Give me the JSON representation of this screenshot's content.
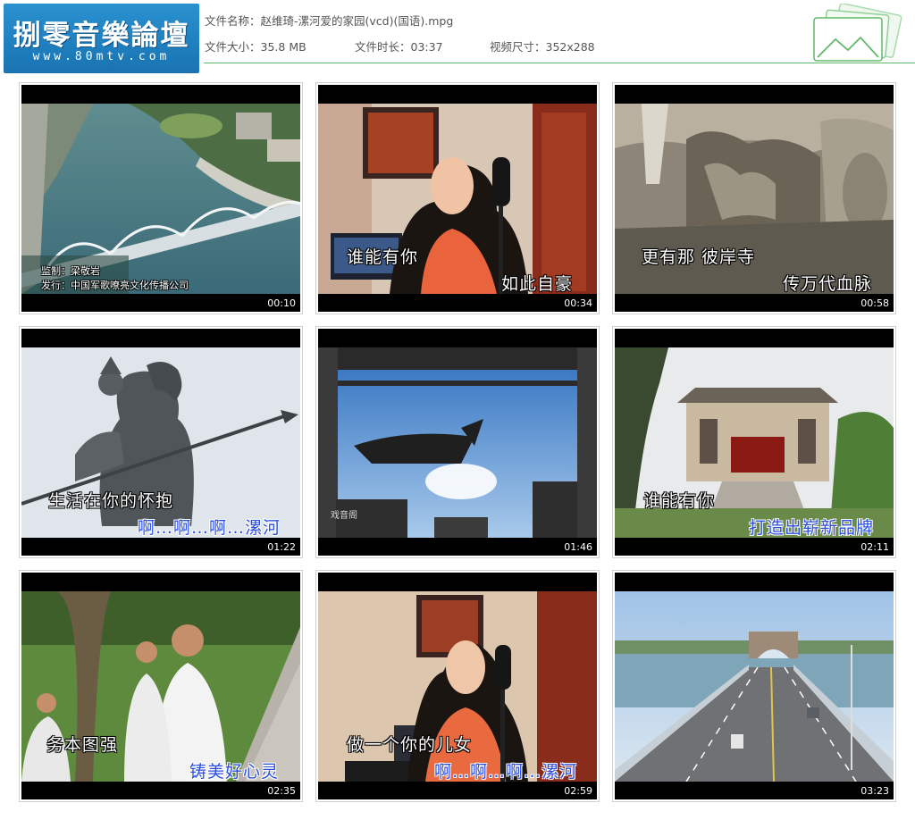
{
  "logo": {
    "title": "捌零音樂論壇",
    "url": "www.80mtv.com"
  },
  "file_info": {
    "name_label": "文件名称：",
    "name_value": "赵维琦-漯河爱的家园(vcd)(国语).mpg",
    "size_label": "文件大小：",
    "size_value": "35.8 MB",
    "duration_label": "文件时长：",
    "duration_value": "03:37",
    "dimensions_label": "视频尺寸：",
    "dimensions_value": "352x288"
  },
  "colors": {
    "accent_green": "#62b96c",
    "logo_blue": "#2a91cf",
    "subtitle_blue": "#2a4de0"
  },
  "thumbnails": [
    {
      "time": "00:10",
      "captions": [
        "监制：梁敬岩",
        "发行：中国军歌嘹亮文化传播公司"
      ]
    },
    {
      "time": "00:34",
      "captions": [
        "谁能有你",
        "如此自豪"
      ]
    },
    {
      "time": "00:58",
      "captions": [
        "更有那 彼岸寺",
        "传万代血脉"
      ]
    },
    {
      "time": "01:22",
      "captions": [
        "生活在你的怀抱",
        "啊…啊…啊…漯河"
      ]
    },
    {
      "time": "01:46",
      "captions": [
        "戏音阁"
      ]
    },
    {
      "time": "02:11",
      "captions": [
        "谁能有你",
        "打造出崭新品牌"
      ]
    },
    {
      "time": "02:35",
      "captions": [
        "务本图强",
        "铸美好心灵"
      ]
    },
    {
      "time": "02:59",
      "captions": [
        "做一个你的儿女",
        "啊…啊…啊…漯河"
      ]
    },
    {
      "time": "03:23",
      "captions": []
    }
  ]
}
